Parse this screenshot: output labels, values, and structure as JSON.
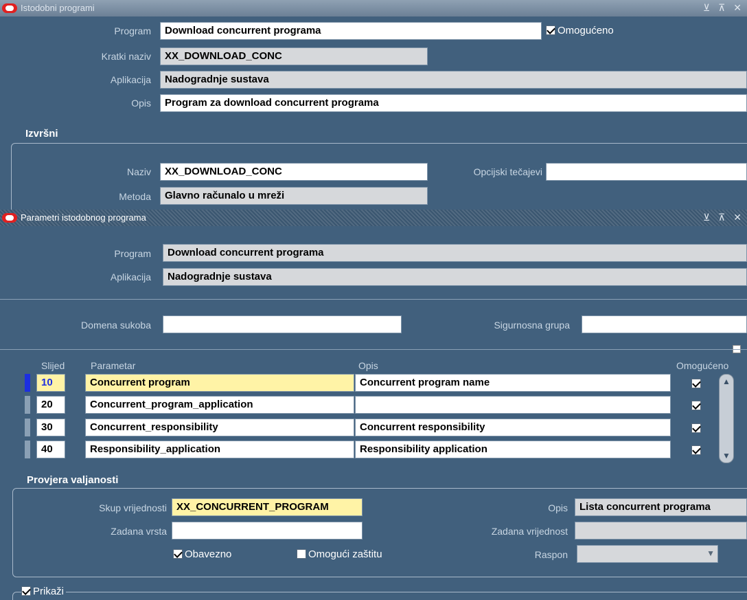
{
  "main_window": {
    "title": "Istodobni programi",
    "controls": "⊻ ⊼ ✕",
    "labels": {
      "program": "Program",
      "short_name": "Kratki naziv",
      "application": "Aplikacija",
      "description": "Opis"
    },
    "values": {
      "program": "Download concurrent programa",
      "short_name": "XX_DOWNLOAD_CONC",
      "application": "Nadogradnje sustava",
      "description": "Program za download concurrent programa"
    },
    "enabled_label": "Omogućeno",
    "enabled": true,
    "executable": {
      "section_title": "Izvršni",
      "name_label": "Naziv",
      "name_value": "XX_DOWNLOAD_CONC",
      "method_label": "Metoda",
      "method_value": "Glavno računalo u mreži",
      "options_label": "Opcijski tečajevi",
      "options_value": ""
    }
  },
  "params_window": {
    "title": "Parametri istodobnog programa",
    "program_label": "Program",
    "program_value": "Download concurrent programa",
    "application_label": "Aplikacija",
    "application_value": "Nadogradnje sustava",
    "conflict_domain_label": "Domena sukoba",
    "conflict_domain_value": "",
    "security_group_label": "Sigurnosna grupa",
    "security_group_value": "",
    "table": {
      "headers": {
        "seq": "Slijed",
        "parameter": "Parametar",
        "description": "Opis",
        "enabled": "Omogućeno"
      },
      "rows": [
        {
          "seq": "10",
          "parameter": "Concurrent program",
          "description": "Concurrent program name",
          "enabled": true
        },
        {
          "seq": "20",
          "parameter": "Concurrent_program_application",
          "description": "",
          "enabled": true
        },
        {
          "seq": "30",
          "parameter": "Concurrent_responsibility",
          "description": "Concurrent responsibility",
          "enabled": true
        },
        {
          "seq": "40",
          "parameter": "Responsibility_application",
          "description": "Responsibility application",
          "enabled": true
        }
      ]
    },
    "validation": {
      "section_title": "Provjera valjanosti",
      "value_set_label": "Skup vrijednosti",
      "value_set_value": "XX_CONCURRENT_PROGRAM",
      "description_label": "Opis",
      "description_value": "Lista concurrent programa",
      "default_type_label": "Zadana vrsta",
      "default_type_value": "",
      "default_value_label": "Zadana vrijednost",
      "default_value_value": "",
      "required_label": "Obavezno",
      "required": true,
      "enable_security_label": "Omogući zaštitu",
      "enable_security": false,
      "range_label": "Raspon",
      "range_value": ""
    },
    "display_label": "Prikaži",
    "display": true
  }
}
